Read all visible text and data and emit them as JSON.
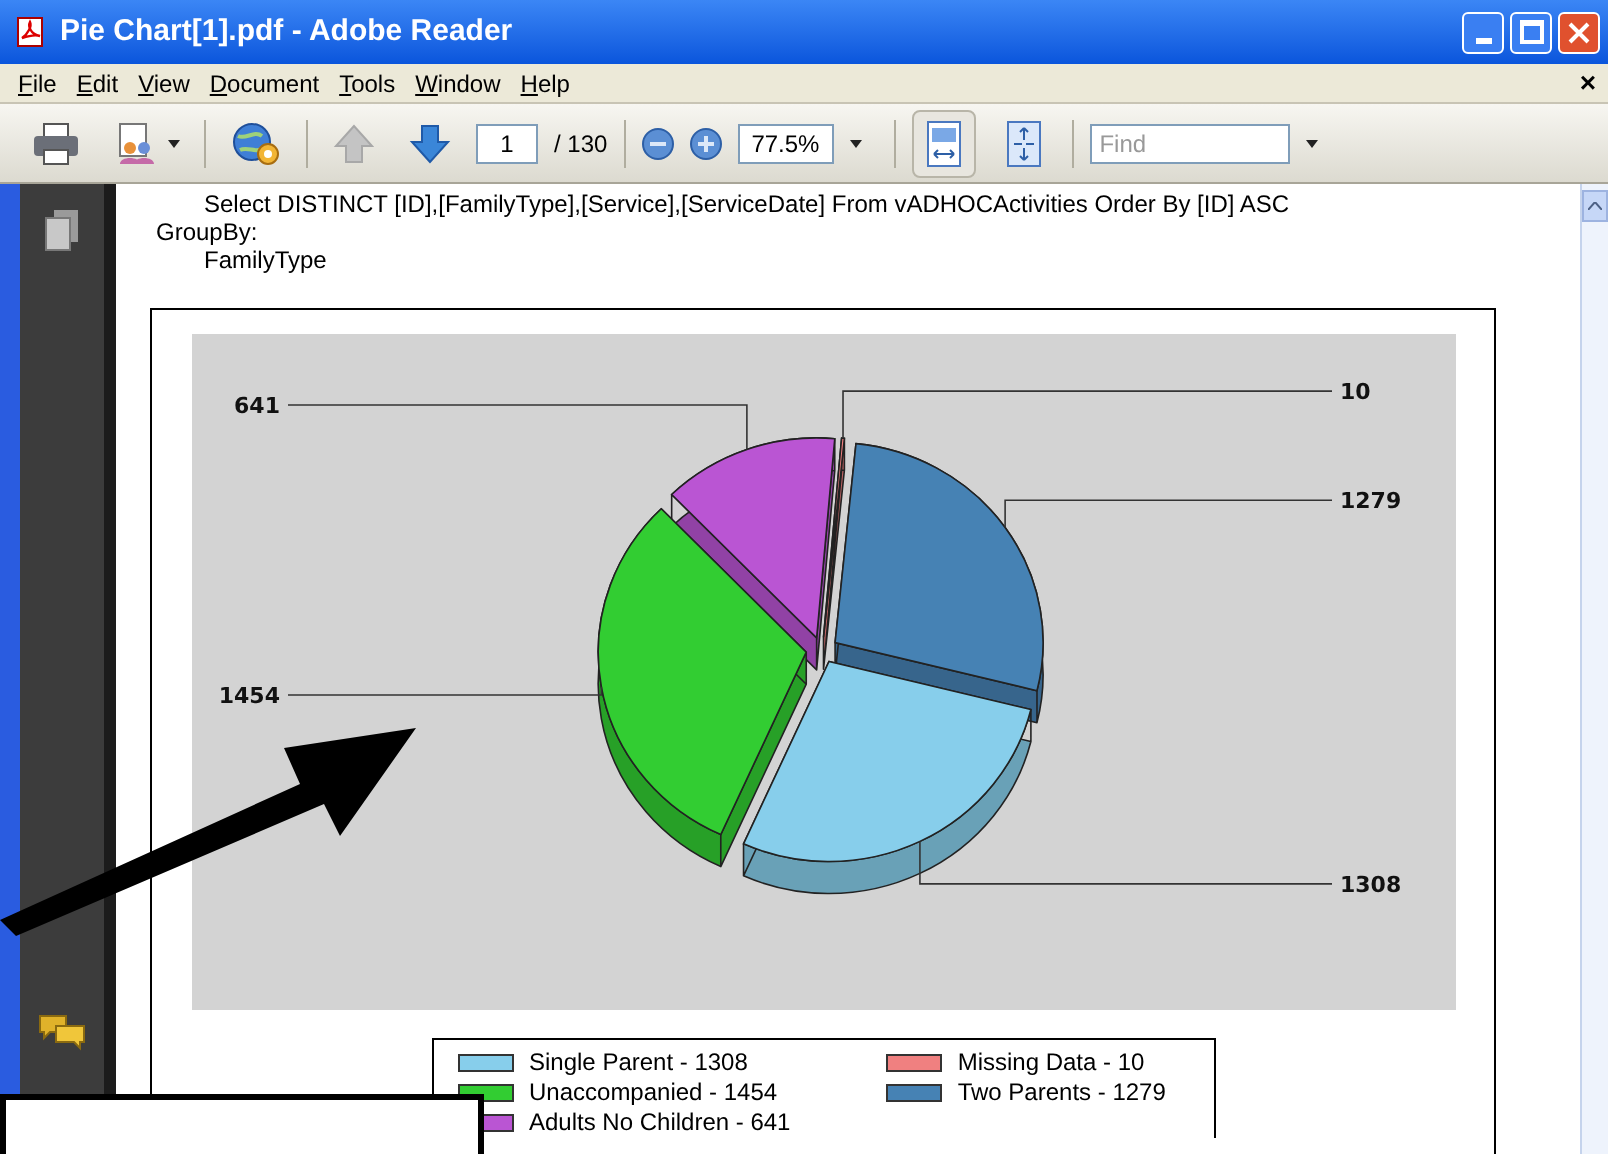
{
  "window": {
    "title": "Pie Chart[1].pdf - Adobe Reader"
  },
  "menu": [
    "File",
    "Edit",
    "View",
    "Document",
    "Tools",
    "Window",
    "Help"
  ],
  "document_close": "×",
  "toolbar": {
    "page": "1",
    "page_total": "/ 130",
    "zoom": "77.5%",
    "find_placeholder": "Find",
    "previous_page_disabled": true,
    "next_page_disabled": false,
    "fit_width_selected": true,
    "fit_page_selected": false
  },
  "document": {
    "query": "Select  DISTINCT [ID],[FamilyType],[Service],[ServiceDate] From vADHOCActivities  Order By [ID] ASC",
    "group_by_label": "GroupBy:",
    "group_by_value": "FamilyType",
    "chart_data": {
      "type": "pie",
      "series": [
        {
          "values": [
            10,
            1279,
            1308,
            1454,
            641
          ],
          "colors": [
            "#f08080",
            "#4682b4",
            "#87ceeb",
            "#32cd32",
            "#ba55d3"
          ]
        }
      ],
      "data_labels": true
    },
    "legend": [
      {
        "label": "Single Parent - 1308",
        "color": "#87ceeb"
      },
      {
        "label": "Unaccompanied - 1454",
        "color": "#32cd32"
      },
      {
        "label": "Adults No Children - 641",
        "color": "#ba55d3"
      },
      {
        "label": "Missing Data - 10",
        "color": "#f08080"
      },
      {
        "label": "Two Parents - 1279",
        "color": "#4682b4"
      }
    ]
  }
}
